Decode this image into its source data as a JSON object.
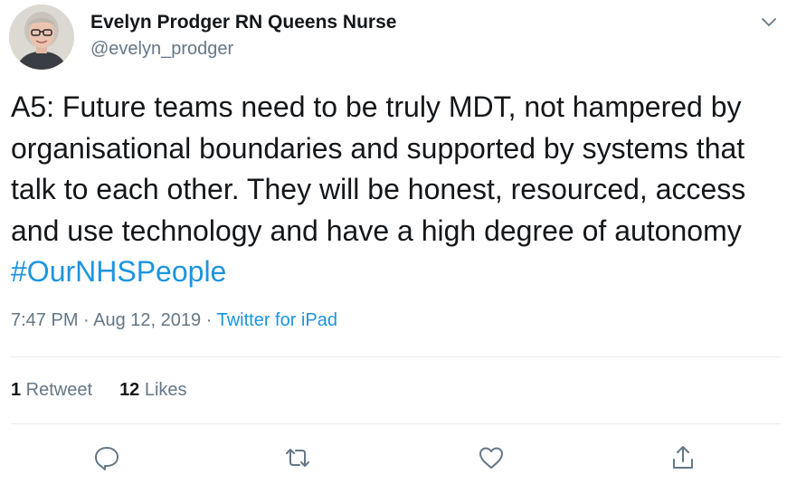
{
  "author": {
    "display_name": "Evelyn Prodger RN Queens Nurse",
    "handle": "@evelyn_prodger"
  },
  "tweet": {
    "text": "A5: Future teams need to be truly MDT, not hampered by organisational boundaries and supported by systems that talk to each other. They will be honest, resourced, access and use technology and have a high degree of autonomy ",
    "hashtag": "#OurNHSPeople",
    "time": "7:47 PM",
    "sep1": " · ",
    "date": "Aug 12, 2019",
    "sep2": " · ",
    "source": "Twitter for iPad"
  },
  "stats": {
    "retweets_count": "1",
    "retweets_label": " Retweet",
    "likes_count": "12",
    "likes_label": " Likes"
  },
  "icons": {
    "more": "chevron-down-icon",
    "reply": "reply-icon",
    "retweet": "retweet-icon",
    "like": "heart-icon",
    "share": "share-icon"
  },
  "colors": {
    "text": "#14171a",
    "secondary": "#657786",
    "link": "#1b95e0",
    "divider": "#e6ecf0"
  }
}
